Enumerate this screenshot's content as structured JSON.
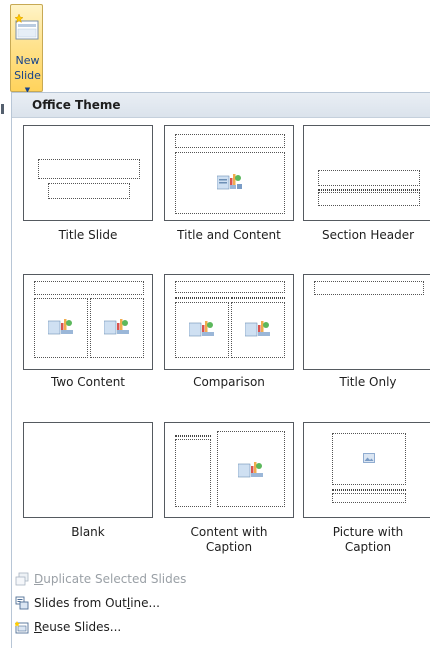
{
  "new_slide_button": {
    "line1": "New",
    "line2": "Slide"
  },
  "menu": {
    "header": "Office Theme",
    "layouts": [
      {
        "name": "Title Slide"
      },
      {
        "name": "Title and Content"
      },
      {
        "name": "Section Header"
      },
      {
        "name": "Two Content"
      },
      {
        "name": "Comparison"
      },
      {
        "name": "Title Only"
      },
      {
        "name": "Blank"
      },
      {
        "name": "Content with",
        "name2": "Caption"
      },
      {
        "name": "Picture with",
        "name2": "Caption"
      }
    ],
    "commands": [
      {
        "mnemonic": "D",
        "rest": "uplicate Selected Slides",
        "enabled": false,
        "icon": "duplicate-slides-icon"
      },
      {
        "pre": "Slides from Out",
        "mnemonic": "l",
        "rest": "ine...",
        "enabled": true,
        "icon": "slides-from-outline-icon"
      },
      {
        "mnemonic": "R",
        "rest": "euse Slides...",
        "enabled": true,
        "icon": "reuse-slides-icon"
      }
    ]
  },
  "colors": {
    "accent": "#ffd35c",
    "header": "#dbe3ec",
    "label_text": "#15428b"
  }
}
